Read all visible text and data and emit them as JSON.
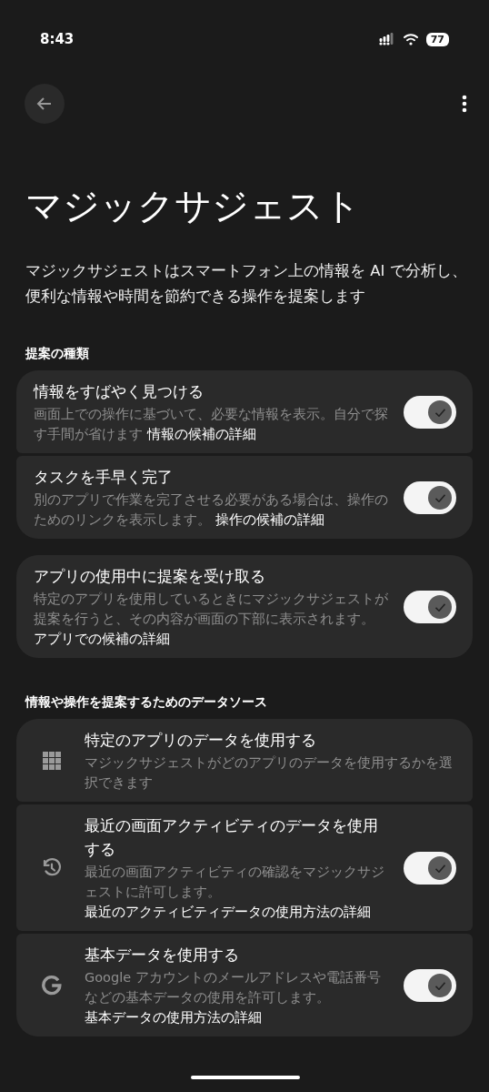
{
  "status_bar": {
    "time": "8:43",
    "battery": "77"
  },
  "title": "マジックサジェスト",
  "description": "マジックサジェストはスマートフォン上の情報を AI で分析し、便利な情報や時間を節約できる操作を提案します",
  "sections": [
    {
      "heading": "提案の種類",
      "groups": [
        {
          "items": [
            {
              "kind": "toggle",
              "title": "情報をすばやく見つける",
              "description": "画面上での操作に基づいて、必要な情報を表示。自分で探す手間が省けます",
              "link": "情報の候補の詳細",
              "on": true
            },
            {
              "kind": "toggle",
              "title": "タスクを手早く完了",
              "description": "別のアプリで作業を完了させる必要がある場合は、操作のためのリンクを表示します。",
              "link": "操作の候補の詳細",
              "on": true
            }
          ]
        },
        {
          "items": [
            {
              "kind": "toggle",
              "title": "アプリの使用中に提案を受け取る",
              "description": "特定のアプリを使用しているときにマジックサジェストが提案を行うと、その内容が画面の下部に表示されます。",
              "link": "アプリでの候補の詳細",
              "on": true
            }
          ]
        }
      ]
    },
    {
      "heading": "情報や操作を提案するためのデータソース",
      "groups": [
        {
          "items": [
            {
              "kind": "navigation",
              "title": "特定のアプリのデータを使用する",
              "description": "マジックサジェストがどのアプリのデータを使用するかを選択できます"
            },
            {
              "kind": "toggle",
              "title": "最近の画面アクティビティのデータを使用する",
              "description": "最近の画面アクティビティの確認をマジックサジェストに許可します。",
              "link": "最近のアクティビティデータの使用方法の詳細",
              "on": true
            },
            {
              "kind": "toggle",
              "title": "基本データを使用する",
              "description": "Google アカウントのメールアドレスや電話番号などの基本データの使用を許可します。",
              "link": "基本データの使用方法の詳細",
              "on": true
            }
          ]
        }
      ]
    }
  ]
}
